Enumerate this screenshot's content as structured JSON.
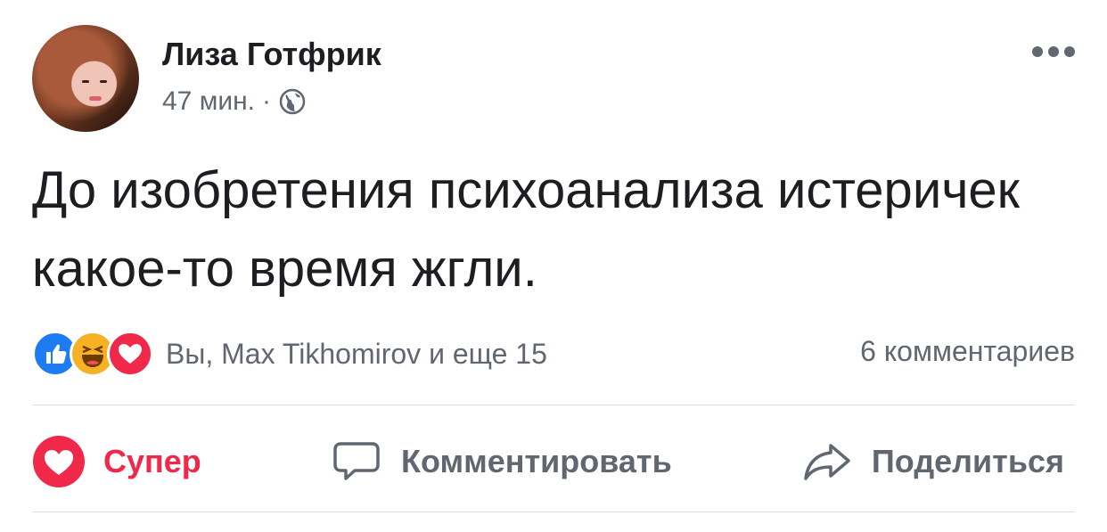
{
  "post": {
    "author": "Лиза Готфрик",
    "time": "47 мин.",
    "separator": "·",
    "privacy_icon": "globe-icon",
    "text": "До изобретения психоанализа истеричек какое-то время жгли."
  },
  "reactions": {
    "icons": [
      "like-icon",
      "haha-icon",
      "love-icon"
    ],
    "summary": "Вы, Max Tikhomirov и еще 15",
    "comments": "6 комментариев"
  },
  "actions": {
    "react_label": "Супер",
    "comment_label": "Комментировать",
    "share_label": "Поделиться"
  },
  "colors": {
    "love": "#f0284a",
    "like": "#1d7cf2",
    "haha": "#f7b125",
    "secondary_text": "#606770",
    "primary_text": "#1c1e21"
  }
}
